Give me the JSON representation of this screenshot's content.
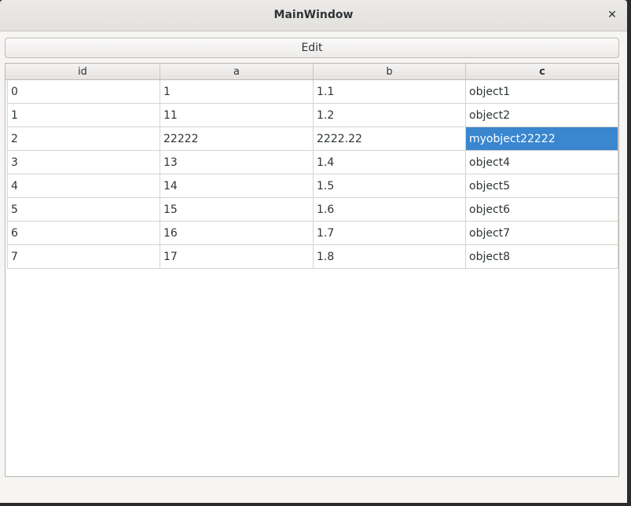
{
  "window": {
    "title": "MainWindow",
    "close_glyph": "✕"
  },
  "toolbar": {
    "edit_label": "Edit"
  },
  "table": {
    "columns": [
      "id",
      "a",
      "b",
      "c"
    ],
    "sorted_column": "c",
    "selected_cell": {
      "row": 2,
      "column": "c"
    },
    "rows": [
      [
        "0",
        "1",
        "1.1",
        "object1"
      ],
      [
        "1",
        "11",
        "1.2",
        "object2"
      ],
      [
        "2",
        "22222",
        "2222.22",
        "myobject22222"
      ],
      [
        "3",
        "13",
        "1.4",
        "object4"
      ],
      [
        "4",
        "14",
        "1.5",
        "object5"
      ],
      [
        "5",
        "15",
        "1.6",
        "object6"
      ],
      [
        "6",
        "16",
        "1.7",
        "object7"
      ],
      [
        "7",
        "17",
        "1.8",
        "object8"
      ]
    ]
  },
  "colors": {
    "selection": "#3a86cf",
    "window_bg": "#f6f5f4",
    "titlebar": "#e3e1de"
  }
}
